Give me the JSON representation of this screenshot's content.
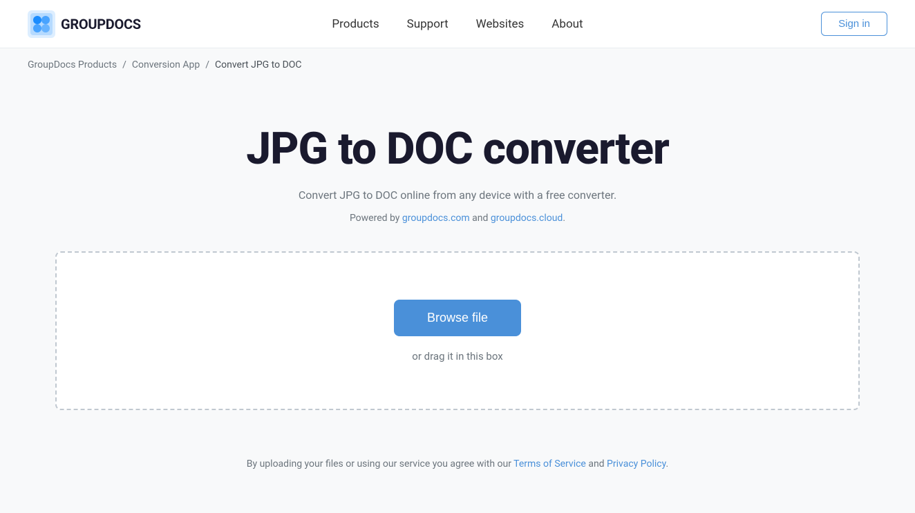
{
  "header": {
    "logo_text": "GROUPDOCS",
    "nav": {
      "products": "Products",
      "support": "Support",
      "websites": "Websites",
      "about": "About"
    },
    "sign_in": "Sign in"
  },
  "breadcrumb": {
    "item1": "GroupDocs Products",
    "separator1": "/",
    "item2": "Conversion App",
    "separator2": "/",
    "current": "Convert JPG to DOC"
  },
  "main": {
    "title": "JPG to DOC converter",
    "subtitle": "Convert JPG to DOC online from any device with a free converter.",
    "powered_by_prefix": "Powered by ",
    "powered_by_link1": "groupdocs.com",
    "powered_by_between": " and ",
    "powered_by_link2": "groupdocs.cloud",
    "powered_by_suffix": ".",
    "browse_btn": "Browse file",
    "drag_text": "or drag it in this box"
  },
  "footer": {
    "note_prefix": "By uploading your files or using our service you agree with our ",
    "tos_link": "Terms of Service",
    "note_and": " and ",
    "privacy_link": "Privacy Policy",
    "note_suffix": "."
  }
}
